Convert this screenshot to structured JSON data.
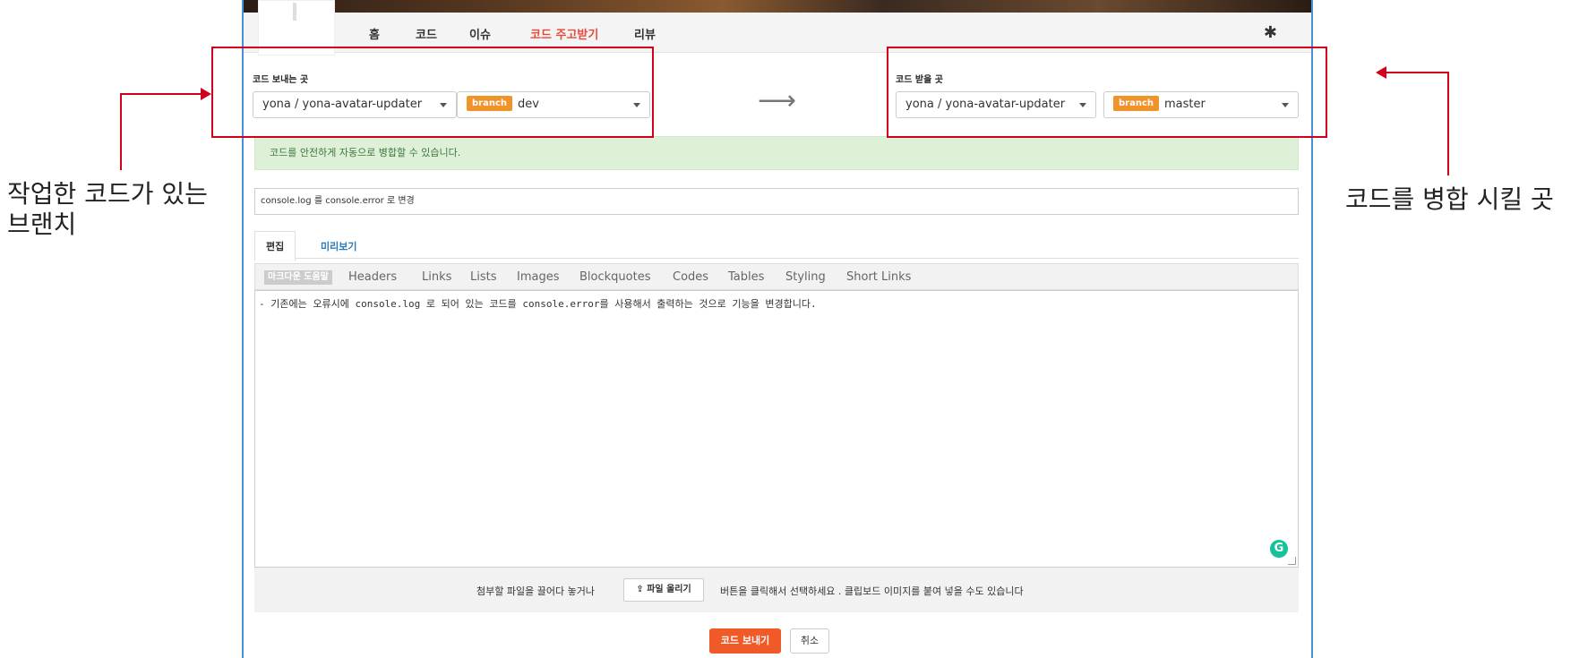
{
  "nav": {
    "items": [
      {
        "label": "홈",
        "active": false
      },
      {
        "label": "코드",
        "active": false
      },
      {
        "label": "이슈",
        "active": false
      },
      {
        "label": "코드 주고받기",
        "active": true
      },
      {
        "label": "리뷰",
        "active": false
      }
    ],
    "settings_icon": "gear-icon"
  },
  "source": {
    "label": "코드 보내는 곳",
    "repo": "yona / yona-avatar-updater",
    "branch_badge": "branch",
    "branch": "dev"
  },
  "target": {
    "label": "코드 받을 곳",
    "repo": "yona / yona-avatar-updater",
    "branch_badge": "branch",
    "branch": "master"
  },
  "direction_arrow": "⟶",
  "merge_status": "코드를 안전하게 자동으로 병합할 수 있습니다.",
  "pr_title": "console.log 를 console.error 로 변경",
  "tabs": {
    "edit": "편집",
    "preview": "미리보기"
  },
  "toolbar": {
    "help": "마크다운 도움말",
    "items": [
      "Headers",
      "Links",
      "Lists",
      "Images",
      "Blockquotes",
      "Codes",
      "Tables",
      "Styling",
      "Short Links"
    ]
  },
  "editor": {
    "content": "- 기존에는 오류시에 console.log 로 되어 있는 코드를 console.error를 사용해서 출력하는 것으로 기능을 변경합니다."
  },
  "attach": {
    "prefix": "첨부할 파일을 끌어다 놓거나",
    "upload_label": "파일 올리기",
    "suffix": "버튼을 클릭해서 선택하세요 . 클립보드 이미지를 붙여 넣을 수도 있습니다"
  },
  "actions": {
    "submit": "코드 보내기",
    "cancel": "취소"
  },
  "annotations": {
    "left_line1": "작업한 코드가 있는",
    "left_line2": "브랜치",
    "right": "코드를 병합 시킬 곳"
  },
  "colors": {
    "accent": "#f05a28",
    "active_nav": "#e8493a",
    "branch_badge": "#f0932b",
    "success_bg": "#dff0d8",
    "annotation_red": "#d0021b"
  }
}
